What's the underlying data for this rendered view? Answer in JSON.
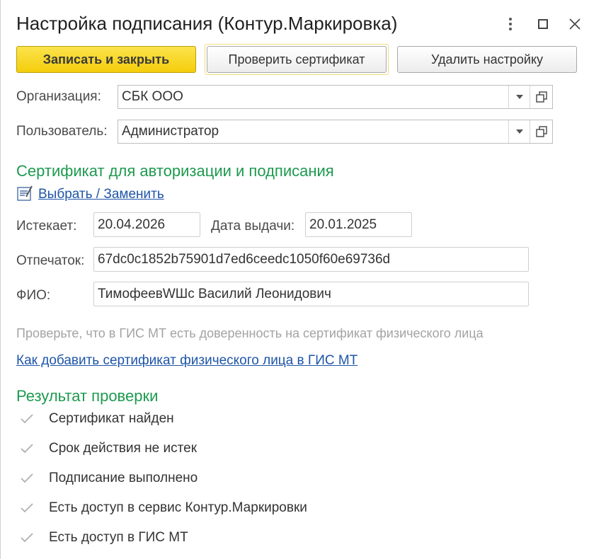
{
  "window": {
    "title": "Настройка подписания (Контур.Маркировка)"
  },
  "toolbar": {
    "save_label": "Записать и закрыть",
    "check_label": "Проверить сертификат",
    "delete_label": "Удалить настройку"
  },
  "form": {
    "organization_label": "Организация:",
    "organization_value": "СБК ООО",
    "user_label": "Пользователь:",
    "user_value": "Администратор"
  },
  "certificate": {
    "section_title": "Сертификат для авторизации и подписания",
    "choose_link": "Выбрать / Заменить",
    "expires_label": "Истекает:",
    "expires_value": "20.04.2026",
    "issued_label": "Дата выдачи:",
    "issued_value": "20.01.2025",
    "thumbprint_label": "Отпечаток:",
    "thumbprint_value": "67dc0c1852b75901d7ed6ceedc1050f60e69736d",
    "fio_label": "ФИО:",
    "fio_value": "ТимофеевWШс Василий Леонидович",
    "hint": "Проверьте, что в ГИС МТ есть доверенность на сертификат физического лица",
    "help_link": "Как добавить сертификат физического лица в ГИС МТ"
  },
  "result": {
    "section_title": "Результат проверки",
    "items": [
      {
        "label": "Сертификат найден"
      },
      {
        "label": "Срок действия не истек"
      },
      {
        "label": "Подписание выполнено"
      },
      {
        "label": "Есть доступ в сервис Контур.Маркировки"
      },
      {
        "label": "Есть доступ в ГИС МТ"
      }
    ]
  },
  "icons": {
    "more": "more-vertical-icon",
    "maximize": "maximize-icon",
    "close": "close-icon",
    "dropdown": "chevron-down-icon",
    "open": "open-form-icon",
    "certificate": "certificate-icon",
    "check": "check-icon"
  },
  "colors": {
    "accent_green": "#1d9a4f",
    "link_blue": "#1e55a8",
    "primary_yellow": "#f4cd0b",
    "check_gray": "#b0b0b0"
  }
}
